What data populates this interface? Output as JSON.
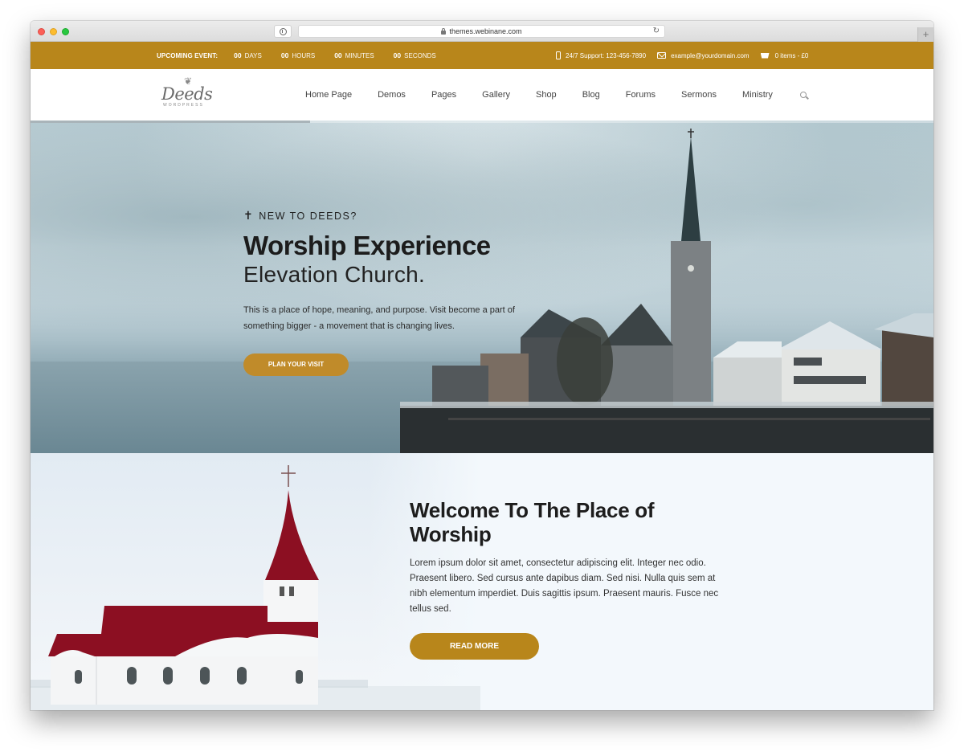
{
  "browser": {
    "url": "themes.webinane.com",
    "new_tab_label": "+"
  },
  "topbar": {
    "event_label": "UPCOMING EVENT:",
    "countdown": [
      {
        "value": "00",
        "unit": "DAYS"
      },
      {
        "value": "00",
        "unit": "HOURS"
      },
      {
        "value": "00",
        "unit": "MINUTES"
      },
      {
        "value": "00",
        "unit": "SECONDS"
      }
    ],
    "support": "24/7 Support: 123-456-7890",
    "email": "example@yourdomain.com",
    "cart": "0 items - £0",
    "color": "#b8861b"
  },
  "header": {
    "logo_text": "Deeds",
    "logo_sub": "WORDPRESS",
    "nav": [
      "Home Page",
      "Demos",
      "Pages",
      "Gallery",
      "Shop",
      "Blog",
      "Forums",
      "Sermons",
      "Ministry"
    ]
  },
  "hero": {
    "slider_progress": 0.31,
    "eyebrow": "NEW TO DEEDS?",
    "title": "Worship Experience",
    "subtitle": "Elevation Church.",
    "text": "This is a place of hope, meaning, and purpose. Visit become a part of something bigger - a movement that is changing lives.",
    "button": "PLAN YOUR VISIT",
    "button_color": "#c08b2a"
  },
  "welcome": {
    "title": "Welcome To The Place of Worship",
    "text": "Lorem ipsum dolor sit amet, consectetur adipiscing elit. Integer nec odio. Praesent libero. Sed cursus ante dapibus diam. Sed nisi. Nulla quis sem at nibh elementum imperdiet. Duis sagittis ipsum. Praesent mauris. Fusce nec tellus sed.",
    "button": "READ MORE",
    "button_color": "#b8861b"
  }
}
